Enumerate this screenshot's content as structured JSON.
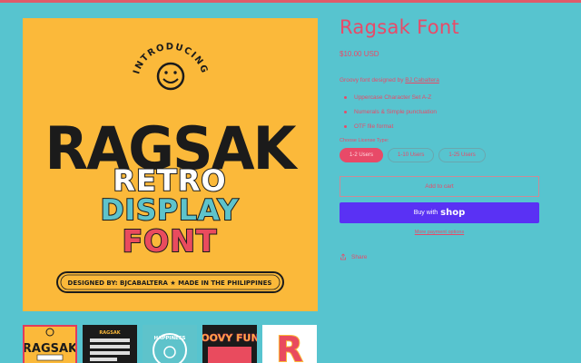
{
  "product": {
    "title": "Ragsak Font",
    "price": "$10.00 USD",
    "description_prefix": "Groovy font designed by ",
    "description_link": "BJ Cabaltera",
    "features": [
      "Uppercase Character Set A-Z",
      "Numerals & Simple punctuation",
      "OTF file format"
    ],
    "option_label": "Choose License Type:",
    "options": [
      "1-2 Users",
      "1-10 Users",
      "1-25 Users"
    ],
    "selected_option": "1-2 Users",
    "add_to_cart": "Add to cart",
    "buy_with": "Buy with",
    "shop_logo": "shop",
    "more_payment": "More payment options",
    "share": "Share"
  },
  "artwork": {
    "intro": "INTRODUCING",
    "name": "RAGSAK",
    "line1": "RETRO",
    "line2": "DISPLAY",
    "line3": "FONT",
    "footer": "DESIGNED BY: BJCABALTERA ★ MADE IN THE PHILIPPINES",
    "colors": {
      "bg": "#fbb93a",
      "name": "#1b1b1b",
      "retro": "#ffffff",
      "display": "#5ec3cb",
      "font": "#e94b5e"
    }
  },
  "thumbnails": [
    {
      "label": "RAGSAK",
      "active": true
    },
    {
      "label": "RAGSAK",
      "active": false
    },
    {
      "label": "HAPPINESS",
      "active": false
    },
    {
      "label": "GROOVY FUNKY",
      "active": false
    },
    {
      "label": "R",
      "active": false
    }
  ],
  "colors": {
    "accent": "#e84a68",
    "page_bg": "#57c4cf",
    "shop_pay": "#5a31f4"
  }
}
